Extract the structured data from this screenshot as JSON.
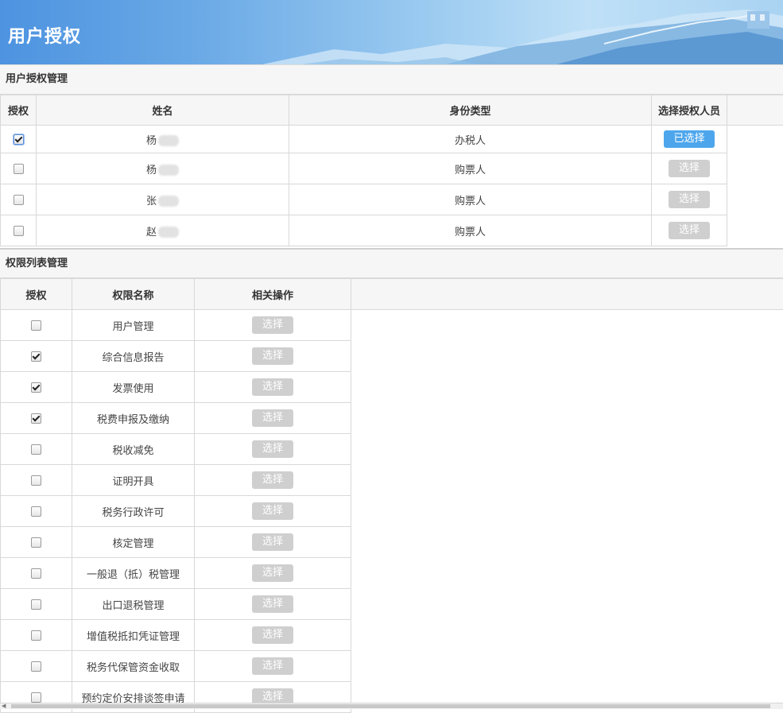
{
  "header": {
    "title": "用户授权"
  },
  "user_section": {
    "title": "用户授权管理",
    "columns": [
      "授权",
      "姓名",
      "身份类型",
      "选择授权人员"
    ],
    "rows": [
      {
        "checked": true,
        "name": "杨",
        "type": "办税人",
        "button": "已选择",
        "selected": true
      },
      {
        "checked": false,
        "name": "杨",
        "type": "购票人",
        "button": "选择",
        "selected": false
      },
      {
        "checked": false,
        "name": "张",
        "type": "购票人",
        "button": "选择",
        "selected": false
      },
      {
        "checked": false,
        "name": "赵",
        "type": "购票人",
        "button": "选择",
        "selected": false
      }
    ]
  },
  "perm_section": {
    "title": "权限列表管理",
    "columns": [
      "授权",
      "权限名称",
      "相关操作"
    ],
    "rows": [
      {
        "checked": false,
        "name": "用户管理",
        "button": "选择"
      },
      {
        "checked": true,
        "name": "综合信息报告",
        "button": "选择"
      },
      {
        "checked": true,
        "name": "发票使用",
        "button": "选择"
      },
      {
        "checked": true,
        "name": "税费申报及缴纳",
        "button": "选择"
      },
      {
        "checked": false,
        "name": "税收减免",
        "button": "选择"
      },
      {
        "checked": false,
        "name": "证明开具",
        "button": "选择"
      },
      {
        "checked": false,
        "name": "税务行政许可",
        "button": "选择"
      },
      {
        "checked": false,
        "name": "核定管理",
        "button": "选择"
      },
      {
        "checked": false,
        "name": "一般退（抵）税管理",
        "button": "选择"
      },
      {
        "checked": false,
        "name": "出口退税管理",
        "button": "选择"
      },
      {
        "checked": false,
        "name": "增值税抵扣凭证管理",
        "button": "选择"
      },
      {
        "checked": false,
        "name": "税务代保管资金收取",
        "button": "选择"
      },
      {
        "checked": false,
        "name": "预约定价安排谈签申请",
        "button": "选择"
      }
    ]
  },
  "colors": {
    "accent": "#4da6ec",
    "disabled": "#cfcfcf"
  }
}
